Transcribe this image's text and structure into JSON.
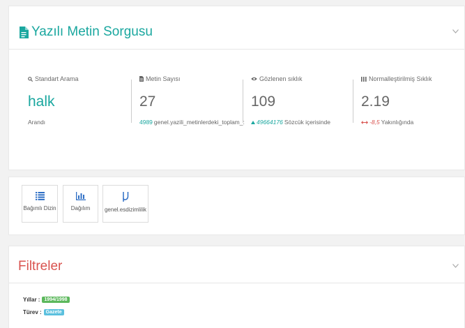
{
  "colors": {
    "accent_teal": "#1aa79f",
    "danger": "#d9534f",
    "green_badge": "#5cb85c",
    "blue_badge": "#5bc0de",
    "link_teal": "#1aa79f"
  },
  "search_panel": {
    "title": "Yazılı Metin Sorgusu",
    "title_icon": "document-icon",
    "collapse_icon": "chevron-down-icon",
    "stats": [
      {
        "icon": "search-icon",
        "label": "Standart Arama",
        "value": "halk",
        "sub_text": "Arandı"
      },
      {
        "icon": "file-icon",
        "label": "Metin Sayısı",
        "value": "27",
        "sub_highlight": "4989",
        "sub_text": "genel.yazili_metinlerdeki_toplam_:"
      },
      {
        "icon": "eye-icon",
        "label": "Gözlenen sıklık",
        "value": "109",
        "sub_highlight": "49664176",
        "sub_text": "Sözcük içerisinde"
      },
      {
        "icon": "bars-icon",
        "label": "Normalleştirilmiş Sıklık",
        "value": "2.19",
        "sub_highlight": "-8,5",
        "sub_text": "Yakınlığında"
      }
    ]
  },
  "tools": [
    {
      "icon": "list-icon",
      "label": "Bağımlı Dizin"
    },
    {
      "icon": "bar-chart-icon",
      "label": "Dağılım"
    },
    {
      "icon": "mu-icon",
      "label": "genel.esdizimlilik"
    }
  ],
  "filters_panel": {
    "title": "Filtreler",
    "collapse_icon": "chevron-down-icon",
    "rows": [
      {
        "label": "Yıllar :",
        "badge": "1994/1998"
      },
      {
        "label": "Türev :",
        "badge": "Gazete"
      }
    ]
  }
}
